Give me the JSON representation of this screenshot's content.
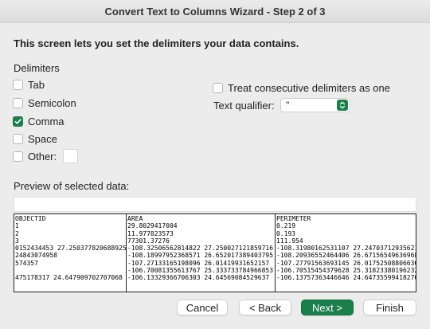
{
  "window": {
    "title": "Convert Text to Columns Wizard - Step 2 of 3"
  },
  "heading": "This screen lets you set the delimiters your data contains.",
  "delimiters": {
    "label": "Delimiters",
    "tab": {
      "label": "Tab",
      "checked": false
    },
    "semicolon": {
      "label": "Semicolon",
      "checked": false
    },
    "comma": {
      "label": "Comma",
      "checked": true
    },
    "space": {
      "label": "Space",
      "checked": false
    },
    "other": {
      "label": "Other:",
      "checked": false,
      "value": ""
    }
  },
  "options": {
    "treat_consecutive": {
      "label": "Treat consecutive delimiters as one",
      "checked": false
    },
    "text_qualifier": {
      "label": "Text qualifier:",
      "value": "\""
    }
  },
  "preview": {
    "label": "Preview of selected data:",
    "columns": [
      "OBJECTID\n1\n2\n3\n0152434453 27.250377820688925\n24843074958\n574357\n\n475178317 24.647909702707068",
      "AREA\n29.8029417004\n11.977823573\n77301.37276\n-108.32506562814822 27.250027121859716\n-108.18997952368571 26.652017389403795\n-107.27133165198096 26.01419931652157\n-106.70081355613767 25.333733784966853\n-106.13329366706303 24.64569084529637",
      "PERIMETER\n0.219\n0.193\n111.954\n-108.31980162531107 27.24703712935621\n-108.20936552464406 26.67156549636968\n-107.27791563693145 26.01752508806636\n-106.70515454379628 25.31823380196232\n-106.13757363446646 24.64735599418276"
    ]
  },
  "buttons": {
    "cancel": "Cancel",
    "back": "< Back",
    "next": "Next >",
    "finish": "Finish"
  },
  "colors": {
    "accent": "#1a7f4b"
  }
}
